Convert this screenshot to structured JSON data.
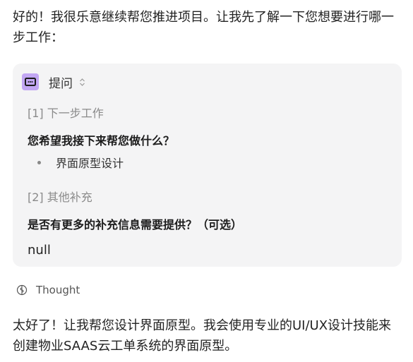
{
  "intro_text": "好的！我很乐意继续帮您推进项目。让我先了解一下您想要进行哪一步工作：",
  "card": {
    "title": "提问",
    "icon": "chat-bubble-icon",
    "accent_color": "#c2a7f3",
    "sections": [
      {
        "label": "[1] 下一步工作",
        "question": "您希望我接下来帮您做什么？",
        "answers": [
          "界面原型设计"
        ]
      },
      {
        "label": "[2] 其他补充",
        "question": "是否有更多的补充信息需要提供？（可选）",
        "value": "null"
      }
    ]
  },
  "thought_label": "Thought",
  "outro_text": "太好了！让我帮您设计界面原型。我会使用专业的UI/UX设计技能来创建物业SAAS云工单系统的界面原型。"
}
